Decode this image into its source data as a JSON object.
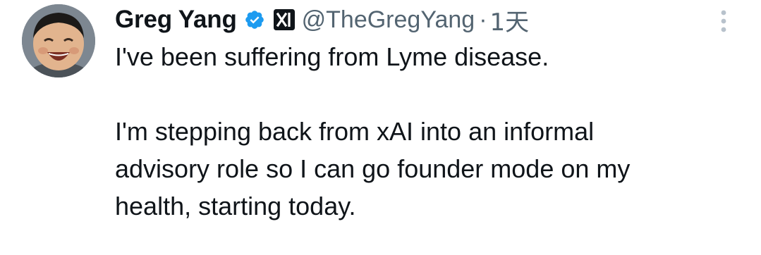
{
  "tweet": {
    "display_name": "Greg Yang",
    "handle": "@TheGregYang",
    "separator": "·",
    "timestamp": "1天",
    "paragraphs": [
      "I've been suffering from Lyme disease.",
      "I'm stepping back from xAI into an informal",
      "advisory role so I can go founder mode on my",
      "health, starting today."
    ],
    "icons": {
      "verified": "verified-badge-icon",
      "affiliate": "xai-affiliate-icon",
      "more": "more-options-icon",
      "avatar": "profile-avatar"
    },
    "colors": {
      "verified": "#1d9bf0",
      "secondary_text": "#536471",
      "primary_text": "#0f1419"
    }
  }
}
